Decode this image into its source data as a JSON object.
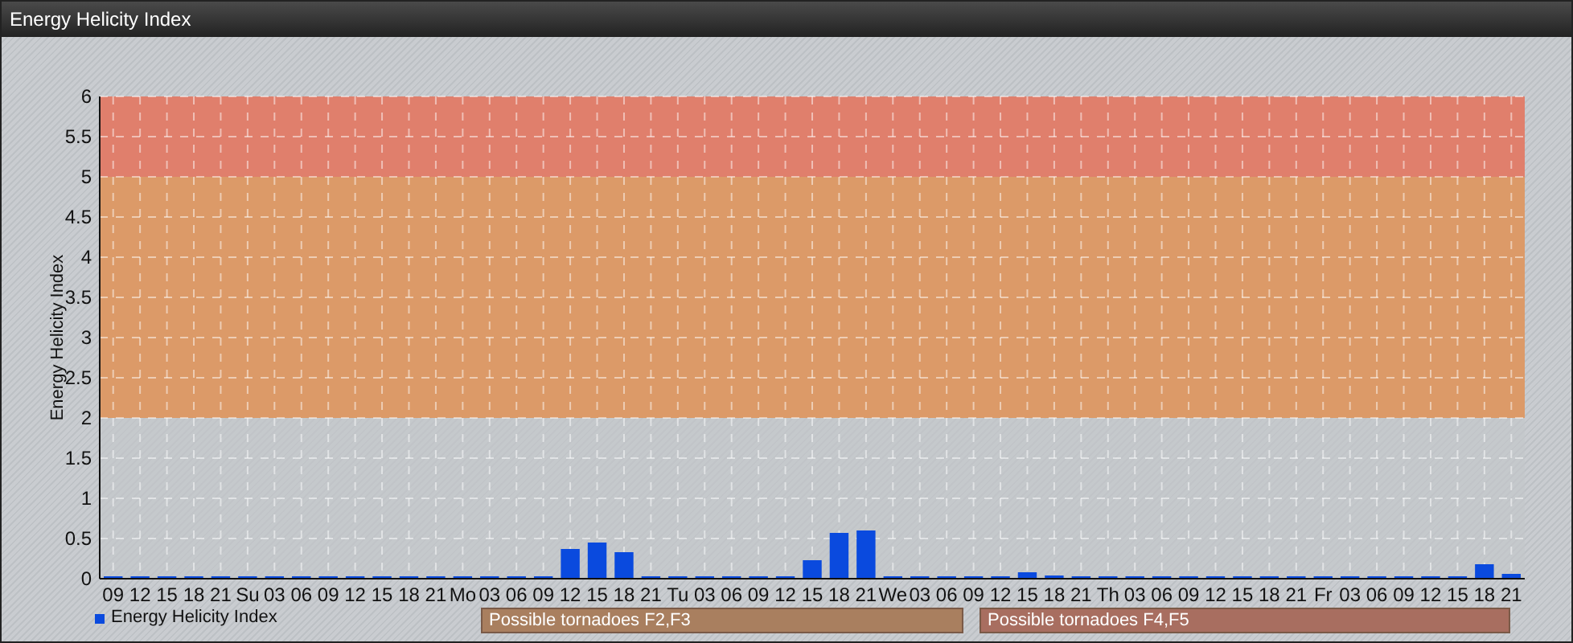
{
  "window": {
    "title": "Energy Helicity Index"
  },
  "chart": {
    "chart_data": {
      "type": "bar",
      "ylabel": "Energy Helicity Index",
      "grid": true,
      "categories": [
        "09",
        "12",
        "15",
        "18",
        "21",
        "Su",
        "03",
        "06",
        "09",
        "12",
        "15",
        "18",
        "21",
        "Mo",
        "03",
        "06",
        "09",
        "12",
        "15",
        "18",
        "21",
        "Tu",
        "03",
        "06",
        "09",
        "12",
        "15",
        "18",
        "21",
        "We",
        "03",
        "06",
        "09",
        "12",
        "15",
        "18",
        "21",
        "Th",
        "03",
        "06",
        "09",
        "12",
        "15",
        "18",
        "21",
        "Fr",
        "03",
        "06",
        "09",
        "12",
        "15",
        "18",
        "21"
      ],
      "series": [
        {
          "name": "Energy Helicity Index",
          "color": "#0a4ade",
          "values": [
            0.01,
            0.01,
            0.01,
            0.01,
            0.01,
            0.01,
            0.01,
            0.01,
            0.01,
            0.01,
            0.01,
            0.01,
            0.03,
            0.01,
            0.01,
            0.01,
            0.01,
            0.37,
            0.45,
            0.33,
            0.01,
            0.01,
            0.01,
            0.01,
            0.01,
            0.01,
            0.23,
            0.57,
            0.6,
            0.01,
            0.01,
            0.01,
            0.01,
            0.02,
            0.08,
            0.04,
            0.01,
            0.01,
            0.01,
            0.01,
            0.01,
            0.01,
            0.01,
            0.01,
            0.03,
            0.01,
            0.01,
            0.01,
            0.01,
            0.01,
            0.01,
            0.18,
            0.06
          ]
        }
      ],
      "ylim": [
        0,
        6
      ],
      "yticks": [
        0,
        0.5,
        1,
        1.5,
        2,
        2.5,
        3,
        3.5,
        4,
        4.5,
        5,
        5.5,
        6
      ],
      "bands": [
        {
          "axis": "y",
          "from": 2,
          "to": 5,
          "color": "#dc9a68"
        },
        {
          "axis": "y",
          "from": 5,
          "to": 6,
          "color": "#e07f6c"
        }
      ]
    },
    "notes": [
      {
        "text": "Possible tornadoes F2,F3",
        "color": "#a97f5f"
      },
      {
        "text": "Possible tornadoes F4,F5",
        "color": "#a86e60"
      }
    ]
  }
}
